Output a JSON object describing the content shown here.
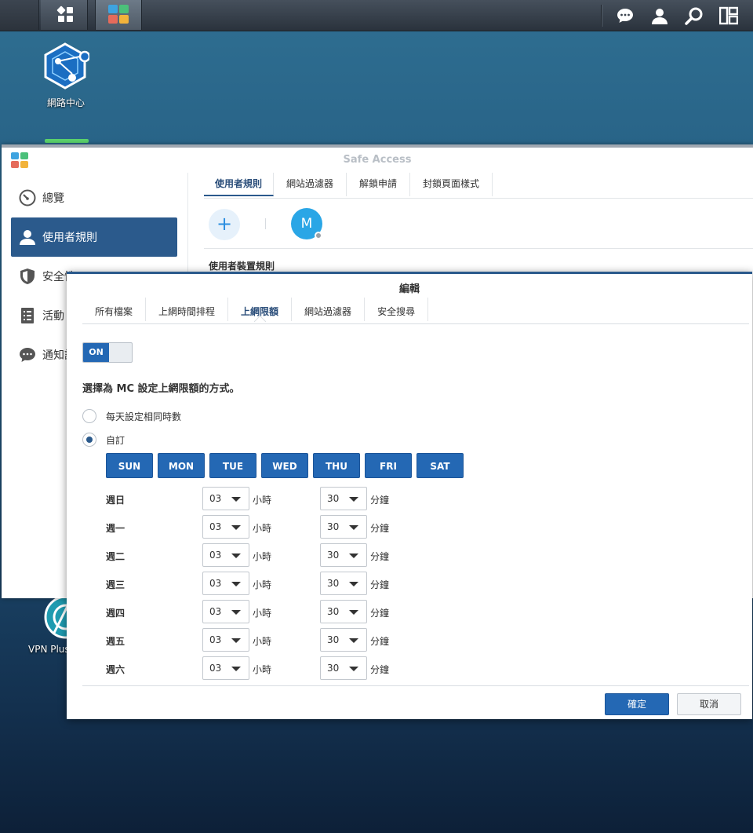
{
  "desktop": {
    "network_center_label": "網路中心",
    "vpn_label": "VPN Plus"
  },
  "window": {
    "title": "Safe Access",
    "sidebar": [
      {
        "label": "總覽",
        "icon": "gauge-icon"
      },
      {
        "label": "使用者規則",
        "icon": "user-icon"
      },
      {
        "label": "安全性",
        "icon": "shield-icon"
      },
      {
        "label": "活動",
        "icon": "list-icon"
      },
      {
        "label": "通知設定",
        "icon": "chat-icon"
      }
    ],
    "tabs": [
      "使用者規則",
      "網站過濾器",
      "解鎖申請",
      "封鎖頁面樣式"
    ],
    "add_label": "+",
    "avatar_letter": "M",
    "section_title": "使用者裝置規則"
  },
  "dialog": {
    "title": "編輯",
    "tabs": [
      "所有檔案",
      "上網時間排程",
      "上網限額",
      "網站過濾器",
      "安全搜尋"
    ],
    "toggle": "ON",
    "description": "選擇為 MC 設定上網限額的方式。",
    "radio_same": "每天設定相同時數",
    "radio_custom": "自訂",
    "days": [
      "SUN",
      "MON",
      "TUE",
      "WED",
      "THU",
      "FRI",
      "SAT"
    ],
    "hour_unit": "小時",
    "minute_unit": "分鐘",
    "rows": [
      {
        "day": "週日",
        "hours": "03",
        "minutes": "30"
      },
      {
        "day": "週一",
        "hours": "03",
        "minutes": "30"
      },
      {
        "day": "週二",
        "hours": "03",
        "minutes": "30"
      },
      {
        "day": "週三",
        "hours": "03",
        "minutes": "30"
      },
      {
        "day": "週四",
        "hours": "03",
        "minutes": "30"
      },
      {
        "day": "週五",
        "hours": "03",
        "minutes": "30"
      },
      {
        "day": "週六",
        "hours": "03",
        "minutes": "30"
      }
    ],
    "ok": "確定",
    "cancel": "取消"
  }
}
